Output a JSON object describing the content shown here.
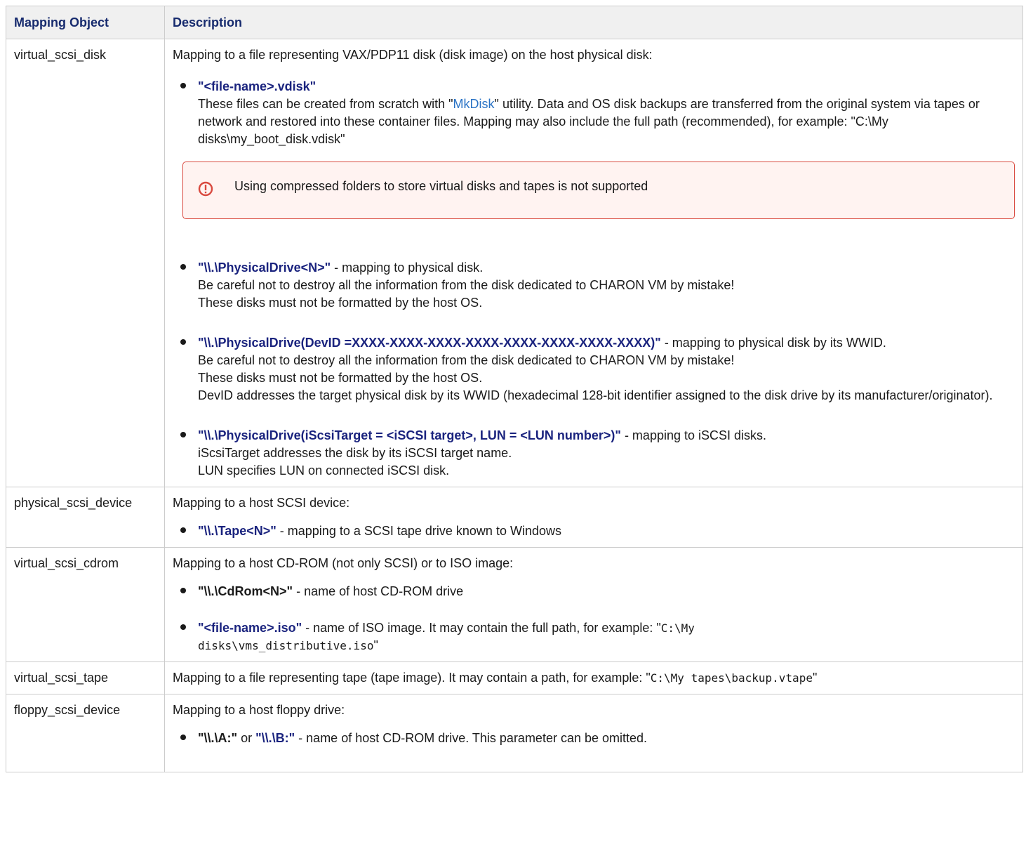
{
  "table": {
    "headers": [
      "Mapping Object",
      "Description"
    ],
    "row1": {
      "name": "virtual_scsi_disk",
      "intro": "Mapping to a file representing VAX/PDP11 disk (disk image) on the host physical disk:",
      "vdisk_code": "\"<file-name>.vdisk\"",
      "vdisk_t1": "These files can be created from scratch with \"",
      "vdisk_link": "MkDisk",
      "vdisk_t2": "\" utility. Data and OS disk backups are transferred from the original system via tapes or network and restored into these container files. Mapping may also include the full path (recommended), for example: \"C:\\My disks\\my_boot_disk.vdisk\"",
      "warning": "Using compressed folders to store virtual disks and tapes is not supported",
      "pd_code": "\"\\\\.\\PhysicalDrive<N>\"",
      "pd_t1": " - mapping to physical disk.",
      "pd_t2": "Be careful not to destroy all the information from the disk dedicated to CHARON VM by mistake!",
      "pd_t3": "These disks must not be formatted by the host OS.",
      "devid_code": "\"\\\\.\\PhysicalDrive(DevID =XXXX-XXXX-XXXX-XXXX-XXXX-XXXX-XXXX-XXXX)\"",
      "devid_t1": " - mapping to physical disk by its WWID.",
      "devid_t2": "Be careful not to destroy all the information from the disk dedicated to CHARON VM by mistake!",
      "devid_t3": "These disks must not be formatted by the host OS.",
      "devid_t4": "DevID addresses the target physical disk by its WWID (hexadecimal 128-bit identifier assigned to the disk drive by its manufacturer/originator).",
      "iscsi_code": "\"\\\\.\\PhysicalDrive(iScsiTarget = <iSCSI target>, LUN = <LUN number>)\"",
      "iscsi_t1": " - mapping to iSCSI disks.",
      "iscsi_t2": "iScsiTarget addresses the disk by its iSCSI target name.",
      "iscsi_t3": "LUN specifies LUN on connected iSCSI disk."
    },
    "row2": {
      "name": "physical_scsi_device",
      "intro": "Mapping to a host SCSI device:",
      "tape_code": "\"\\\\.\\Tape<N>\"",
      "tape_t1": " - mapping to a SCSI tape drive known to Windows"
    },
    "row3": {
      "name": "virtual_scsi_cdrom",
      "intro": "Mapping to a host CD-ROM (not only SCSI) or to ISO image:",
      "cd_code": "\"\\\\.\\CdRom<N>\"",
      "cd_t1": " - name of host CD-ROM drive",
      "iso_code": "\"<file-name>.iso\"",
      "iso_t1": " - name of ISO image. It may contain the full path, for example: \"",
      "iso_path_1": "C:\\My",
      "iso_path_2": "disks\\vms_distributive.iso",
      "iso_t2": "\""
    },
    "row4": {
      "name": "virtual_scsi_tape",
      "t1": "Mapping to a file representing tape (tape image). It may contain a path, for example: \"",
      "path": "C:\\My tapes\\backup.vtape",
      "t2": "\""
    },
    "row5": {
      "name": "floppy_scsi_device",
      "intro": "Mapping to a host floppy drive:",
      "a_code": "\"\\\\.\\A:\"",
      "or": " or ",
      "b_code": "\"\\\\.\\B:\"",
      "t1": " - name of host CD-ROM drive. This parameter can be omitted."
    }
  },
  "colors": {
    "header_bg": "#f0f0f0",
    "header_text": "#172b6e",
    "code_text": "#1a237e",
    "link": "#2a73c5",
    "warning_border": "#d9493f",
    "warning_bg": "#fff3f1"
  },
  "icons": {
    "warning": "exclamation-circle-icon",
    "bullet": "disc-bullet"
  }
}
